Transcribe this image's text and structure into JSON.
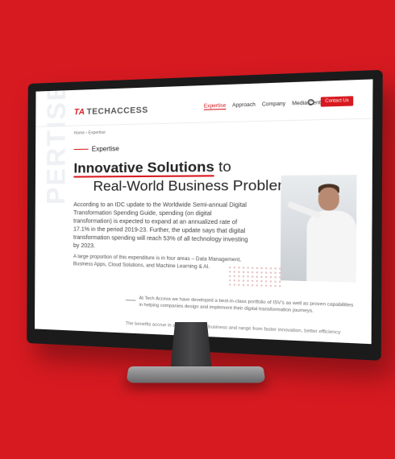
{
  "site": {
    "logo_text": "TECHACCESS",
    "logo_mark": "TA",
    "nav": [
      "Expertise",
      "Approach",
      "Company",
      "Media Centre"
    ],
    "contact_label": "Contact Us",
    "breadcrumb": "Home › Expertise",
    "section_label": "Expertise",
    "watermark": "PERTISE",
    "title_highlight": "Innovative Solutions",
    "title_rest": "to",
    "title_line2": "Real-World Business Problems",
    "paragraph1": "According to an IDC update to the Worldwide Semi-annual Digital Transformation Spending Guide, spending (on digital transformation) is expected to expand at an annualized rate of 17.1% in the period 2019-23. Further, the update says that digital transformation spending will reach 53% of all technology investing by 2023.",
    "paragraph2": "A large proportion of this expenditure is in four areas – Data Management, Business Apps, Cloud Solutions, and Machine Learning & AI.",
    "quote": "At Tech Access we have developed a best-in-class portfolio of ISV's as well as proven capabilities in helping companies design and implement their digital transformation journeys.",
    "footer": "The benefits accrue in all areas of your business and range from faster innovation, better efficiency"
  },
  "colors": {
    "brand": "#d71920",
    "background": "#d71920"
  }
}
